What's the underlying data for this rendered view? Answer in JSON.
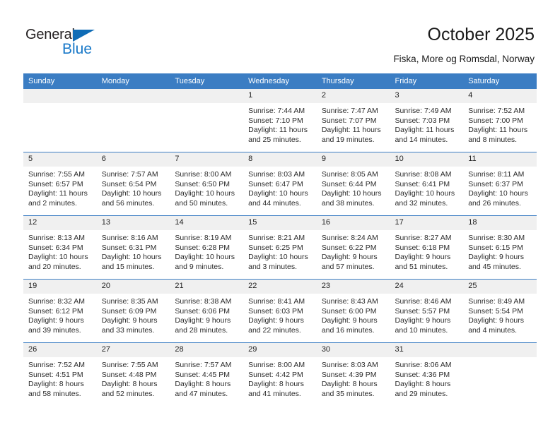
{
  "brand": {
    "name_top": "General",
    "name_bottom": "Blue",
    "triangle_color": "#0f6cb6",
    "text_color": "#231f20",
    "blue_color": "#1878c8"
  },
  "header": {
    "title": "October 2025",
    "location": "Fiska, More og Romsdal, Norway",
    "accent_color": "#3b7dc3",
    "daynum_background": "#f0f0f0"
  },
  "weekdays": [
    "Sunday",
    "Monday",
    "Tuesday",
    "Wednesday",
    "Thursday",
    "Friday",
    "Saturday"
  ],
  "weeks": [
    [
      {
        "day": "",
        "sunrise": "",
        "sunset": "",
        "daylight": ""
      },
      {
        "day": "",
        "sunrise": "",
        "sunset": "",
        "daylight": ""
      },
      {
        "day": "",
        "sunrise": "",
        "sunset": "",
        "daylight": ""
      },
      {
        "day": "1",
        "sunrise": "Sunrise: 7:44 AM",
        "sunset": "Sunset: 7:10 PM",
        "daylight": "Daylight: 11 hours and 25 minutes."
      },
      {
        "day": "2",
        "sunrise": "Sunrise: 7:47 AM",
        "sunset": "Sunset: 7:07 PM",
        "daylight": "Daylight: 11 hours and 19 minutes."
      },
      {
        "day": "3",
        "sunrise": "Sunrise: 7:49 AM",
        "sunset": "Sunset: 7:03 PM",
        "daylight": "Daylight: 11 hours and 14 minutes."
      },
      {
        "day": "4",
        "sunrise": "Sunrise: 7:52 AM",
        "sunset": "Sunset: 7:00 PM",
        "daylight": "Daylight: 11 hours and 8 minutes."
      }
    ],
    [
      {
        "day": "5",
        "sunrise": "Sunrise: 7:55 AM",
        "sunset": "Sunset: 6:57 PM",
        "daylight": "Daylight: 11 hours and 2 minutes."
      },
      {
        "day": "6",
        "sunrise": "Sunrise: 7:57 AM",
        "sunset": "Sunset: 6:54 PM",
        "daylight": "Daylight: 10 hours and 56 minutes."
      },
      {
        "day": "7",
        "sunrise": "Sunrise: 8:00 AM",
        "sunset": "Sunset: 6:50 PM",
        "daylight": "Daylight: 10 hours and 50 minutes."
      },
      {
        "day": "8",
        "sunrise": "Sunrise: 8:03 AM",
        "sunset": "Sunset: 6:47 PM",
        "daylight": "Daylight: 10 hours and 44 minutes."
      },
      {
        "day": "9",
        "sunrise": "Sunrise: 8:05 AM",
        "sunset": "Sunset: 6:44 PM",
        "daylight": "Daylight: 10 hours and 38 minutes."
      },
      {
        "day": "10",
        "sunrise": "Sunrise: 8:08 AM",
        "sunset": "Sunset: 6:41 PM",
        "daylight": "Daylight: 10 hours and 32 minutes."
      },
      {
        "day": "11",
        "sunrise": "Sunrise: 8:11 AM",
        "sunset": "Sunset: 6:37 PM",
        "daylight": "Daylight: 10 hours and 26 minutes."
      }
    ],
    [
      {
        "day": "12",
        "sunrise": "Sunrise: 8:13 AM",
        "sunset": "Sunset: 6:34 PM",
        "daylight": "Daylight: 10 hours and 20 minutes."
      },
      {
        "day": "13",
        "sunrise": "Sunrise: 8:16 AM",
        "sunset": "Sunset: 6:31 PM",
        "daylight": "Daylight: 10 hours and 15 minutes."
      },
      {
        "day": "14",
        "sunrise": "Sunrise: 8:19 AM",
        "sunset": "Sunset: 6:28 PM",
        "daylight": "Daylight: 10 hours and 9 minutes."
      },
      {
        "day": "15",
        "sunrise": "Sunrise: 8:21 AM",
        "sunset": "Sunset: 6:25 PM",
        "daylight": "Daylight: 10 hours and 3 minutes."
      },
      {
        "day": "16",
        "sunrise": "Sunrise: 8:24 AM",
        "sunset": "Sunset: 6:22 PM",
        "daylight": "Daylight: 9 hours and 57 minutes."
      },
      {
        "day": "17",
        "sunrise": "Sunrise: 8:27 AM",
        "sunset": "Sunset: 6:18 PM",
        "daylight": "Daylight: 9 hours and 51 minutes."
      },
      {
        "day": "18",
        "sunrise": "Sunrise: 8:30 AM",
        "sunset": "Sunset: 6:15 PM",
        "daylight": "Daylight: 9 hours and 45 minutes."
      }
    ],
    [
      {
        "day": "19",
        "sunrise": "Sunrise: 8:32 AM",
        "sunset": "Sunset: 6:12 PM",
        "daylight": "Daylight: 9 hours and 39 minutes."
      },
      {
        "day": "20",
        "sunrise": "Sunrise: 8:35 AM",
        "sunset": "Sunset: 6:09 PM",
        "daylight": "Daylight: 9 hours and 33 minutes."
      },
      {
        "day": "21",
        "sunrise": "Sunrise: 8:38 AM",
        "sunset": "Sunset: 6:06 PM",
        "daylight": "Daylight: 9 hours and 28 minutes."
      },
      {
        "day": "22",
        "sunrise": "Sunrise: 8:41 AM",
        "sunset": "Sunset: 6:03 PM",
        "daylight": "Daylight: 9 hours and 22 minutes."
      },
      {
        "day": "23",
        "sunrise": "Sunrise: 8:43 AM",
        "sunset": "Sunset: 6:00 PM",
        "daylight": "Daylight: 9 hours and 16 minutes."
      },
      {
        "day": "24",
        "sunrise": "Sunrise: 8:46 AM",
        "sunset": "Sunset: 5:57 PM",
        "daylight": "Daylight: 9 hours and 10 minutes."
      },
      {
        "day": "25",
        "sunrise": "Sunrise: 8:49 AM",
        "sunset": "Sunset: 5:54 PM",
        "daylight": "Daylight: 9 hours and 4 minutes."
      }
    ],
    [
      {
        "day": "26",
        "sunrise": "Sunrise: 7:52 AM",
        "sunset": "Sunset: 4:51 PM",
        "daylight": "Daylight: 8 hours and 58 minutes."
      },
      {
        "day": "27",
        "sunrise": "Sunrise: 7:55 AM",
        "sunset": "Sunset: 4:48 PM",
        "daylight": "Daylight: 8 hours and 52 minutes."
      },
      {
        "day": "28",
        "sunrise": "Sunrise: 7:57 AM",
        "sunset": "Sunset: 4:45 PM",
        "daylight": "Daylight: 8 hours and 47 minutes."
      },
      {
        "day": "29",
        "sunrise": "Sunrise: 8:00 AM",
        "sunset": "Sunset: 4:42 PM",
        "daylight": "Daylight: 8 hours and 41 minutes."
      },
      {
        "day": "30",
        "sunrise": "Sunrise: 8:03 AM",
        "sunset": "Sunset: 4:39 PM",
        "daylight": "Daylight: 8 hours and 35 minutes."
      },
      {
        "day": "31",
        "sunrise": "Sunrise: 8:06 AM",
        "sunset": "Sunset: 4:36 PM",
        "daylight": "Daylight: 8 hours and 29 minutes."
      },
      {
        "day": "",
        "sunrise": "",
        "sunset": "",
        "daylight": ""
      }
    ]
  ]
}
